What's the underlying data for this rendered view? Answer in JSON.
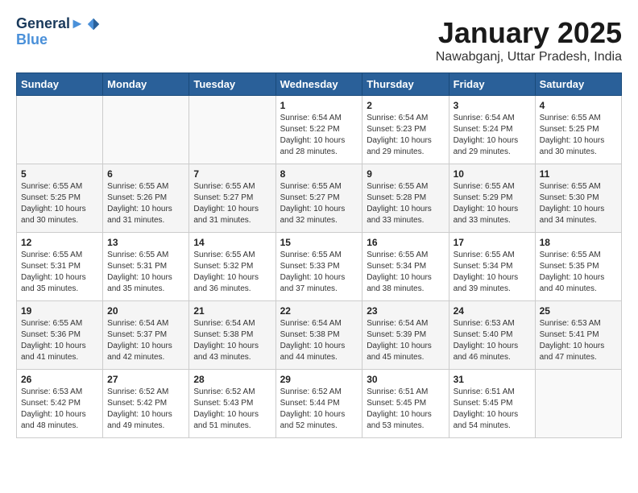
{
  "header": {
    "logo_line1": "General",
    "logo_line2": "Blue",
    "month": "January 2025",
    "location": "Nawabganj, Uttar Pradesh, India"
  },
  "weekdays": [
    "Sunday",
    "Monday",
    "Tuesday",
    "Wednesday",
    "Thursday",
    "Friday",
    "Saturday"
  ],
  "weeks": [
    [
      {
        "day": "",
        "info": ""
      },
      {
        "day": "",
        "info": ""
      },
      {
        "day": "",
        "info": ""
      },
      {
        "day": "1",
        "info": "Sunrise: 6:54 AM\nSunset: 5:22 PM\nDaylight: 10 hours\nand 28 minutes."
      },
      {
        "day": "2",
        "info": "Sunrise: 6:54 AM\nSunset: 5:23 PM\nDaylight: 10 hours\nand 29 minutes."
      },
      {
        "day": "3",
        "info": "Sunrise: 6:54 AM\nSunset: 5:24 PM\nDaylight: 10 hours\nand 29 minutes."
      },
      {
        "day": "4",
        "info": "Sunrise: 6:55 AM\nSunset: 5:25 PM\nDaylight: 10 hours\nand 30 minutes."
      }
    ],
    [
      {
        "day": "5",
        "info": "Sunrise: 6:55 AM\nSunset: 5:25 PM\nDaylight: 10 hours\nand 30 minutes."
      },
      {
        "day": "6",
        "info": "Sunrise: 6:55 AM\nSunset: 5:26 PM\nDaylight: 10 hours\nand 31 minutes."
      },
      {
        "day": "7",
        "info": "Sunrise: 6:55 AM\nSunset: 5:27 PM\nDaylight: 10 hours\nand 31 minutes."
      },
      {
        "day": "8",
        "info": "Sunrise: 6:55 AM\nSunset: 5:27 PM\nDaylight: 10 hours\nand 32 minutes."
      },
      {
        "day": "9",
        "info": "Sunrise: 6:55 AM\nSunset: 5:28 PM\nDaylight: 10 hours\nand 33 minutes."
      },
      {
        "day": "10",
        "info": "Sunrise: 6:55 AM\nSunset: 5:29 PM\nDaylight: 10 hours\nand 33 minutes."
      },
      {
        "day": "11",
        "info": "Sunrise: 6:55 AM\nSunset: 5:30 PM\nDaylight: 10 hours\nand 34 minutes."
      }
    ],
    [
      {
        "day": "12",
        "info": "Sunrise: 6:55 AM\nSunset: 5:31 PM\nDaylight: 10 hours\nand 35 minutes."
      },
      {
        "day": "13",
        "info": "Sunrise: 6:55 AM\nSunset: 5:31 PM\nDaylight: 10 hours\nand 35 minutes."
      },
      {
        "day": "14",
        "info": "Sunrise: 6:55 AM\nSunset: 5:32 PM\nDaylight: 10 hours\nand 36 minutes."
      },
      {
        "day": "15",
        "info": "Sunrise: 6:55 AM\nSunset: 5:33 PM\nDaylight: 10 hours\nand 37 minutes."
      },
      {
        "day": "16",
        "info": "Sunrise: 6:55 AM\nSunset: 5:34 PM\nDaylight: 10 hours\nand 38 minutes."
      },
      {
        "day": "17",
        "info": "Sunrise: 6:55 AM\nSunset: 5:34 PM\nDaylight: 10 hours\nand 39 minutes."
      },
      {
        "day": "18",
        "info": "Sunrise: 6:55 AM\nSunset: 5:35 PM\nDaylight: 10 hours\nand 40 minutes."
      }
    ],
    [
      {
        "day": "19",
        "info": "Sunrise: 6:55 AM\nSunset: 5:36 PM\nDaylight: 10 hours\nand 41 minutes."
      },
      {
        "day": "20",
        "info": "Sunrise: 6:54 AM\nSunset: 5:37 PM\nDaylight: 10 hours\nand 42 minutes."
      },
      {
        "day": "21",
        "info": "Sunrise: 6:54 AM\nSunset: 5:38 PM\nDaylight: 10 hours\nand 43 minutes."
      },
      {
        "day": "22",
        "info": "Sunrise: 6:54 AM\nSunset: 5:38 PM\nDaylight: 10 hours\nand 44 minutes."
      },
      {
        "day": "23",
        "info": "Sunrise: 6:54 AM\nSunset: 5:39 PM\nDaylight: 10 hours\nand 45 minutes."
      },
      {
        "day": "24",
        "info": "Sunrise: 6:53 AM\nSunset: 5:40 PM\nDaylight: 10 hours\nand 46 minutes."
      },
      {
        "day": "25",
        "info": "Sunrise: 6:53 AM\nSunset: 5:41 PM\nDaylight: 10 hours\nand 47 minutes."
      }
    ],
    [
      {
        "day": "26",
        "info": "Sunrise: 6:53 AM\nSunset: 5:42 PM\nDaylight: 10 hours\nand 48 minutes."
      },
      {
        "day": "27",
        "info": "Sunrise: 6:52 AM\nSunset: 5:42 PM\nDaylight: 10 hours\nand 49 minutes."
      },
      {
        "day": "28",
        "info": "Sunrise: 6:52 AM\nSunset: 5:43 PM\nDaylight: 10 hours\nand 51 minutes."
      },
      {
        "day": "29",
        "info": "Sunrise: 6:52 AM\nSunset: 5:44 PM\nDaylight: 10 hours\nand 52 minutes."
      },
      {
        "day": "30",
        "info": "Sunrise: 6:51 AM\nSunset: 5:45 PM\nDaylight: 10 hours\nand 53 minutes."
      },
      {
        "day": "31",
        "info": "Sunrise: 6:51 AM\nSunset: 5:45 PM\nDaylight: 10 hours\nand 54 minutes."
      },
      {
        "day": "",
        "info": ""
      }
    ]
  ]
}
